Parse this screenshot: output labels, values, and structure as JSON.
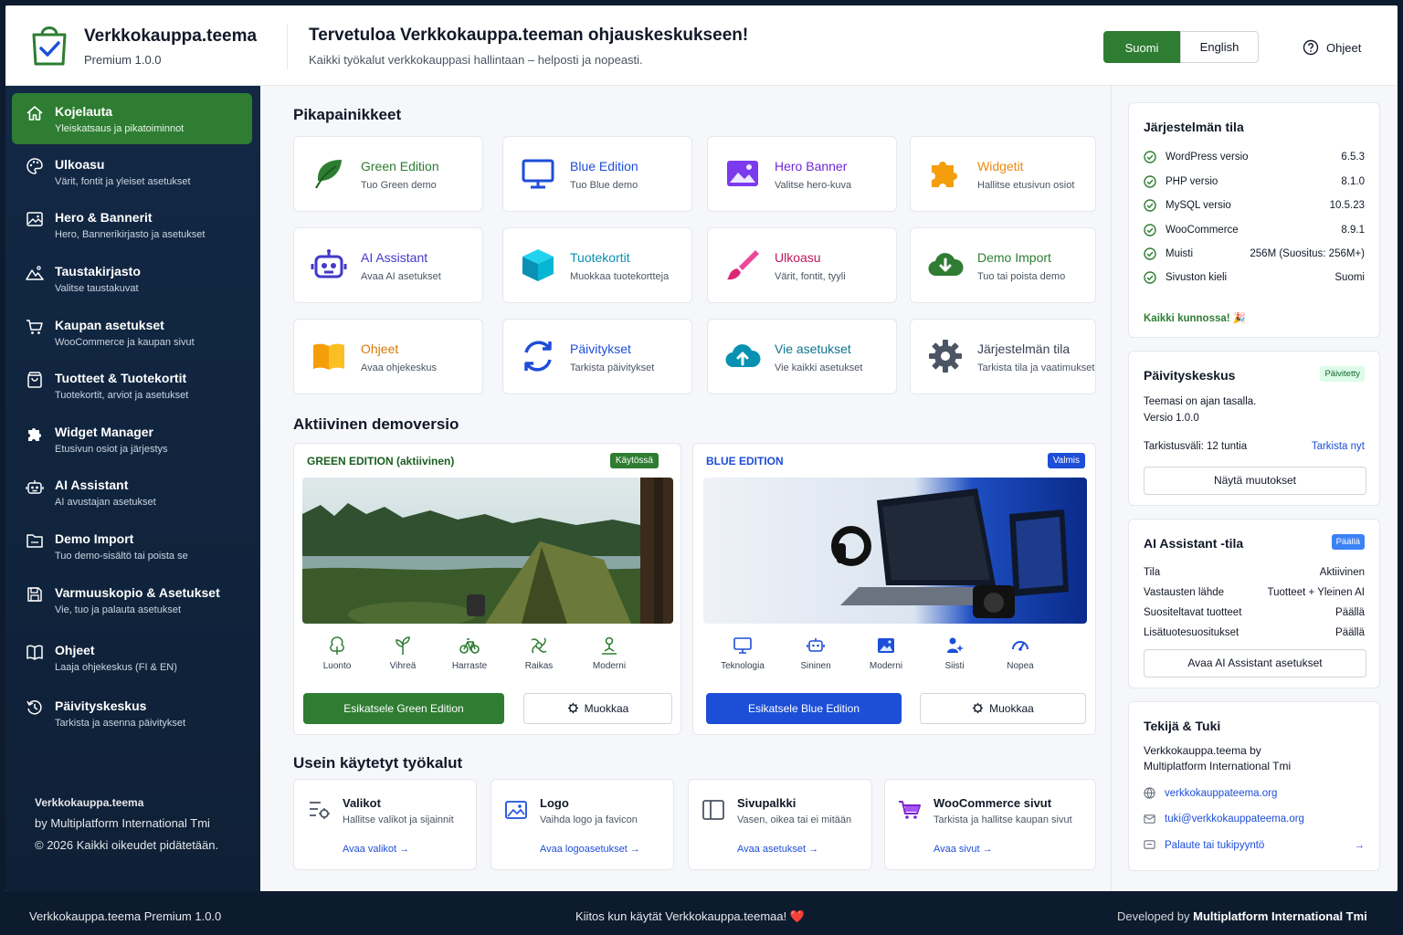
{
  "header": {
    "brand_title": "Verkkokauppa.teema",
    "brand_version": "Premium 1.0.0",
    "welcome_title": "Tervetuloa Verkkokauppa.teeman ohjauskeskukseen!",
    "welcome_subtitle": "Kaikki työkalut verkkokauppasi hallintaan – helposti ja nopeasti.",
    "lang_fi": "Suomi",
    "lang_en": "English",
    "help_label": "Ohjeet"
  },
  "sidebar": {
    "items": [
      {
        "label": "Kojelauta",
        "sub": "Yleiskatsaus ja pikatoiminnot",
        "icon": "home-icon",
        "active": true
      },
      {
        "label": "Ulkoasu",
        "sub": "Värit, fontit ja yleiset asetukset",
        "icon": "palette-icon"
      },
      {
        "label": "Hero & Bannerit",
        "sub": "Hero, Bannerikirjasto ja asetukset",
        "icon": "image-icon"
      },
      {
        "label": "Taustakirjasto",
        "sub": "Valitse taustakuvat",
        "icon": "mountain-icon"
      },
      {
        "label": "Kaupan asetukset",
        "sub": "WooCommerce ja kaupan sivut",
        "icon": "cart-icon"
      },
      {
        "label": "Tuotteet & Tuotekortit",
        "sub": "Tuotekortit, arviot ja asetukset",
        "icon": "bag-icon"
      },
      {
        "label": "Widget Manager",
        "sub": "Etusivun osiot ja järjestys",
        "icon": "puzzle-icon"
      },
      {
        "label": "AI Assistant",
        "sub": "AI avustajan asetukset",
        "icon": "robot-icon"
      },
      {
        "label": "Demo Import",
        "sub": "Tuo demo-sisältö tai poista se",
        "icon": "folder-icon"
      },
      {
        "label": "Varmuuskopio & Asetukset",
        "sub": "Vie, tuo ja palauta asetukset",
        "icon": "save-icon"
      },
      {
        "label": "Ohjeet",
        "sub": "Laaja ohjekeskus (FI & EN)",
        "icon": "book-icon"
      },
      {
        "label": "Päivityskeskus",
        "sub": "Tarkista ja asenna päivitykset",
        "icon": "update-icon"
      }
    ],
    "footer_name": "Verkkokauppa.teema",
    "footer_by": "by Multiplatform International Tmi",
    "footer_copy": "© 2026 Kaikki oikeudet pidätetään."
  },
  "quick": {
    "title": "Pikapainikkeet",
    "items": [
      {
        "title": "Green Edition",
        "sub": "Tuo Green demo",
        "color": "#2e7d32",
        "icon": "leaf-icon"
      },
      {
        "title": "Blue Edition",
        "sub": "Tuo Blue demo",
        "color": "#1d4ed8",
        "icon": "monitor-icon"
      },
      {
        "title": "Hero Banner",
        "sub": "Valitse hero-kuva",
        "color": "#6d28d9",
        "icon": "picture-icon"
      },
      {
        "title": "Widgetit",
        "sub": "Hallitse etusivun osiot",
        "color": "#ea8a0c",
        "icon": "puzzle-icon"
      },
      {
        "title": "AI Assistant",
        "sub": "Avaa AI asetukset",
        "color": "#4338ca",
        "icon": "robot-icon"
      },
      {
        "title": "Tuotekortit",
        "sub": "Muokkaa tuotekortteja",
        "color": "#0891b2",
        "icon": "box-icon"
      },
      {
        "title": "Ulkoasu",
        "sub": "Värit, fontit, tyyli",
        "color": "#be185d",
        "icon": "brush-icon"
      },
      {
        "title": "Demo Import",
        "sub": "Tuo tai poista demo",
        "color": "#2e7d32",
        "icon": "cloud-download-icon"
      },
      {
        "title": "Ohjeet",
        "sub": "Avaa ohjekeskus",
        "color": "#d97706",
        "icon": "book-icon"
      },
      {
        "title": "Päivitykset",
        "sub": "Tarkista päivitykset",
        "color": "#1d4ed8",
        "icon": "refresh-icon"
      },
      {
        "title": "Vie asetukset",
        "sub": "Vie kaikki asetukset",
        "color": "#0e7490",
        "icon": "cloud-upload-icon"
      },
      {
        "title": "Järjestelmän tila",
        "sub": "Tarkista tila ja vaatimukset",
        "color": "#374151",
        "icon": "gear-icon"
      }
    ]
  },
  "demos": {
    "title": "Aktiivinen demoversio",
    "green": {
      "title": "GREEN EDITION (aktiivinen)",
      "badge": "Käytössä",
      "features": [
        "Luonto",
        "Vihreä",
        "Harraste",
        "Raikas",
        "Moderni"
      ],
      "preview": "Esikatsele Green Edition",
      "edit": "Muokkaa"
    },
    "blue": {
      "title": "BLUE EDITION",
      "badge": "Valmis",
      "features": [
        "Teknologia",
        "Sininen",
        "Moderni",
        "Siisti",
        "Nopea"
      ],
      "preview": "Esikatsele Blue Edition",
      "edit": "Muokkaa"
    }
  },
  "tools": {
    "title": "Usein käytetyt työkalut",
    "items": [
      {
        "title": "Valikot",
        "sub": "Hallitse valikot ja sijainnit",
        "link": "Avaa valikot →"
      },
      {
        "title": "Logo",
        "sub": "Vaihda logo ja favicon",
        "link": "Avaa logoasetukset →"
      },
      {
        "title": "Sivupalkki",
        "sub": "Vasen, oikea tai ei mitään",
        "link": "Avaa asetukset →"
      },
      {
        "title": "WooCommerce sivut",
        "sub": "Tarkista ja hallitse kaupan sivut",
        "link": "Avaa sivut →"
      }
    ]
  },
  "system": {
    "title": "Järjestelmän tila",
    "rows": [
      {
        "label": "WordPress versio",
        "value": "6.5.3"
      },
      {
        "label": "PHP versio",
        "value": "8.1.0"
      },
      {
        "label": "MySQL versio",
        "value": "10.5.23"
      },
      {
        "label": "WooCommerce",
        "value": "8.9.1"
      },
      {
        "label": "Muisti",
        "value": "256M (Suositus: 256M+)"
      },
      {
        "label": "Sivuston kieli",
        "value": "Suomi"
      }
    ],
    "ok": "Kaikki kunnossa! 🎉"
  },
  "updates": {
    "title": "Päivityskeskus",
    "badge": "Päivitetty",
    "line1": "Teemasi on ajan tasalla.",
    "line2": "Versio 1.0.0",
    "interval": "Tarkistusväli: 12 tuntia",
    "check": "Tarkista nyt",
    "button": "Näytä muutokset"
  },
  "ai": {
    "title": "AI Assistant -tila",
    "badge": "Päällä",
    "rows": [
      {
        "label": "Tila",
        "value": "Aktiivinen"
      },
      {
        "label": "Vastausten lähde",
        "value": "Tuotteet + Yleinen AI"
      },
      {
        "label": "Suositeltavat tuotteet",
        "value": "Päällä"
      },
      {
        "label": "Lisätuotesuositukset",
        "value": "Päällä"
      }
    ],
    "button": "Avaa AI Assistant asetukset"
  },
  "support": {
    "title": "Tekijä & Tuki",
    "line1": "Verkkokauppa.teema by",
    "line2": "Multiplatform International Tmi",
    "website": "verkkokauppateema.org",
    "email": "tuki@verkkokauppateema.org",
    "feedback": "Palaute tai tukipyyntö"
  },
  "footer": {
    "left": "Verkkokauppa.teema Premium 1.0.0",
    "center": "Kiitos kun käytät Verkkokauppa.teemaa! ❤️",
    "right_prefix": "Developed by",
    "right_name": "Multiplatform International Tmi"
  }
}
